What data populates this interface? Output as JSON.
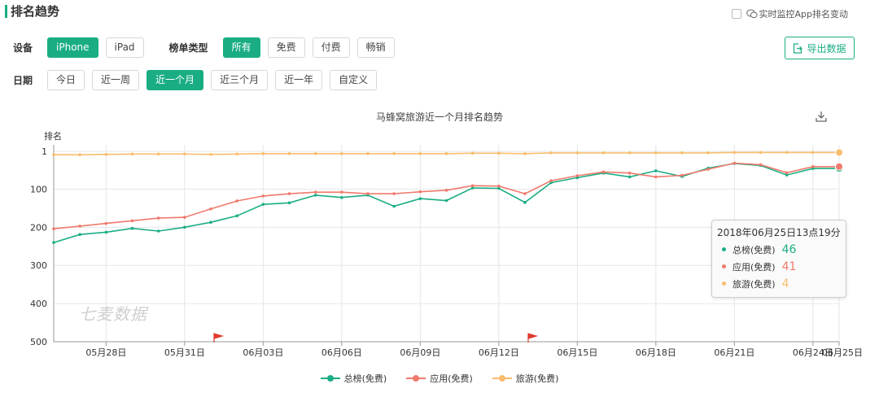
{
  "header": {
    "title": "排名趋势",
    "monitor_label": "实时监控App排名变动"
  },
  "filters": {
    "device_label": "设备",
    "devices": [
      {
        "label": "iPhone",
        "active": true
      },
      {
        "label": "iPad",
        "active": false
      }
    ],
    "list_type_label": "榜单类型",
    "list_types": [
      {
        "label": "所有",
        "active": true
      },
      {
        "label": "免费",
        "active": false
      },
      {
        "label": "付费",
        "active": false
      },
      {
        "label": "畅销",
        "active": false
      }
    ],
    "date_label": "日期",
    "dates": [
      {
        "label": "今日",
        "active": false
      },
      {
        "label": "近一周",
        "active": false
      },
      {
        "label": "近一个月",
        "active": true
      },
      {
        "label": "近三个月",
        "active": false
      },
      {
        "label": "近一年",
        "active": false
      },
      {
        "label": "自定义",
        "active": false
      }
    ],
    "export_label": "导出数据"
  },
  "colors": {
    "accent": "#1aad84",
    "series_total": "#1aad84",
    "series_app": "#f07a6c",
    "series_travel": "#f9bd6e",
    "grid": "#e6e6e6",
    "marker_flag": "#e03a2d"
  },
  "watermark": "七麦数据",
  "tooltip": {
    "time": "2018年06月25日13点19分",
    "rows": [
      {
        "name": "总榜(免费)",
        "value": "46",
        "color": "#1aad84"
      },
      {
        "name": "应用(免费)",
        "value": "41",
        "color": "#f07a6c"
      },
      {
        "name": "旅游(免费)",
        "value": "4",
        "color": "#f9bd6e"
      }
    ]
  },
  "chart_data": {
    "type": "line",
    "title": "马蜂窝旅游近一个月排名趋势",
    "ylabel": "排名",
    "y_inverted": true,
    "ylim": [
      1,
      500
    ],
    "yticks": [
      1,
      100,
      200,
      300,
      400,
      500
    ],
    "xticks": [
      "05月28日",
      "05月31日",
      "06月03日",
      "06月06日",
      "06月09日",
      "06月12日",
      "06月15日",
      "06月18日",
      "06月21日",
      "06月24日",
      "06月25日"
    ],
    "x": [
      "05月26日",
      "05月27日",
      "05月28日",
      "05月29日",
      "05月30日",
      "05月31日",
      "06月01日",
      "06月02日",
      "06月03日",
      "06月04日",
      "06月05日",
      "06月06日",
      "06月07日",
      "06月08日",
      "06月09日",
      "06月10日",
      "06月11日",
      "06月12日",
      "06月13日",
      "06月14日",
      "06月15日",
      "06月16日",
      "06月17日",
      "06月18日",
      "06月19日",
      "06月20日",
      "06月21日",
      "06月22日",
      "06月23日",
      "06月24日",
      "06月25日"
    ],
    "series": [
      {
        "name": "总榜(免费)",
        "color": "#1aad84",
        "values": [
          240,
          219,
          213,
          203,
          210,
          200,
          187,
          170,
          140,
          136,
          116,
          122,
          116,
          145,
          125,
          130,
          97,
          98,
          135,
          83,
          70,
          58,
          68,
          52,
          67,
          45,
          33,
          38,
          63,
          46,
          46
        ]
      },
      {
        "name": "应用(免费)",
        "color": "#f07a6c",
        "values": [
          204,
          197,
          190,
          183,
          176,
          174,
          152,
          131,
          118,
          112,
          108,
          108,
          112,
          112,
          107,
          103,
          91,
          92,
          112,
          78,
          65,
          55,
          58,
          68,
          64,
          48,
          32,
          36,
          57,
          41,
          41
        ]
      },
      {
        "name": "旅游(免费)",
        "color": "#f9bd6e",
        "values": [
          10,
          10,
          9,
          8,
          8,
          8,
          9,
          8,
          7,
          7,
          7,
          7,
          7,
          7,
          7,
          7,
          6,
          6,
          7,
          5,
          5,
          5,
          5,
          5,
          5,
          5,
          4,
          4,
          4,
          4,
          4
        ]
      }
    ],
    "flags": [
      "06月01日",
      "06月13日"
    ],
    "grid": true,
    "legend_position": "bottom"
  }
}
